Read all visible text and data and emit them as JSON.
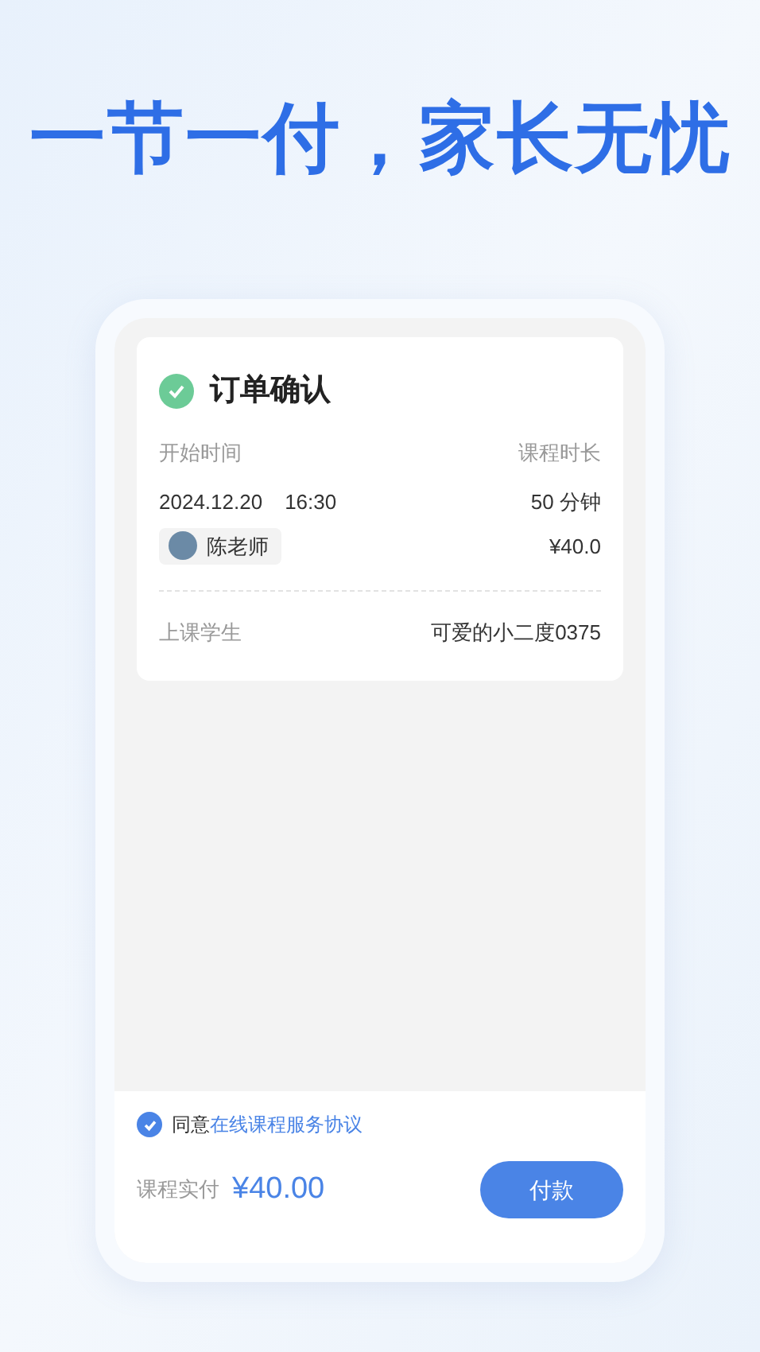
{
  "headline": "一节一付，家长无忧",
  "order": {
    "title": "订单确认",
    "confirmed": true,
    "start_label": "开始时间",
    "duration_label": "课程时长",
    "date": "2024.12.20",
    "time": "16:30",
    "duration": "50 分钟",
    "teacher": "陈老师",
    "price": "¥40.0",
    "student_label": "上课学生",
    "student": "可爱的小二度0375"
  },
  "footer": {
    "agree": {
      "checked": true,
      "text": "同意",
      "link": "在线课程服务协议"
    },
    "paid_label": "课程实付",
    "paid_amount": "¥40.00",
    "pay_button": "付款"
  }
}
